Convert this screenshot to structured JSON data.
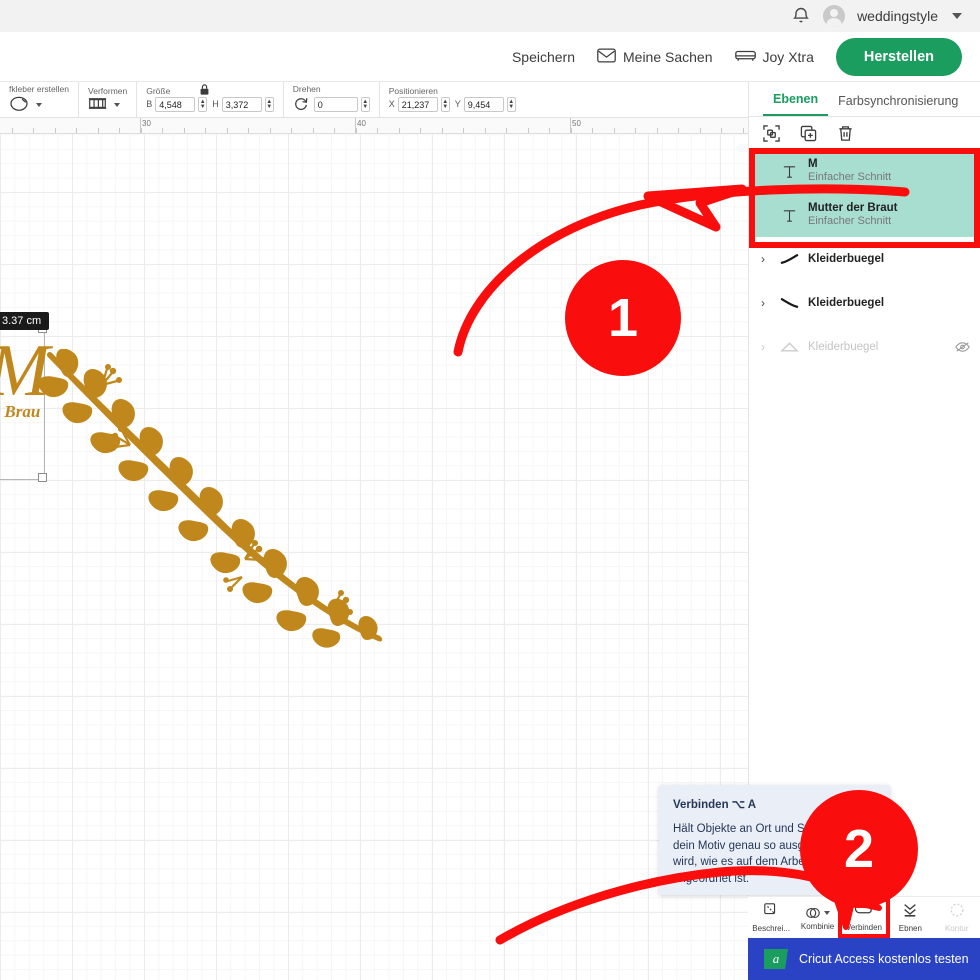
{
  "account_bar": {
    "bell_icon": "bell-icon",
    "avatar_icon": "avatar",
    "username": "weddingstyle",
    "caret_icon": "chevron-down-icon"
  },
  "header": {
    "save_label": "Speichern",
    "my_stuff_label": "Meine Sachen",
    "my_stuff_icon": "envelope-icon",
    "machine_label": "Joy Xtra",
    "machine_icon": "machine-icon",
    "make_button": "Herstellen",
    "make_button_color": "#1a9d5e"
  },
  "prop_toolbar": {
    "groups": [
      {
        "label": "fkleber erstellen",
        "icon": "sticker-icon",
        "has_dropdown": true
      },
      {
        "label": "Verformen",
        "icon": "warp-icon",
        "has_dropdown": true
      }
    ],
    "size": {
      "label": "Größe",
      "lock_icon": "lock-icon",
      "width_prefix": "B",
      "width_value": "4,548",
      "height_prefix": "H",
      "height_value": "3,372"
    },
    "rotate": {
      "label": "Drehen",
      "icon": "rotate-icon",
      "value": "0"
    },
    "position": {
      "label": "Positionieren",
      "x_prefix": "X",
      "x_value": "21,237",
      "y_prefix": "Y",
      "y_value": "9,454"
    }
  },
  "ruler": {
    "marks": [
      "30",
      "40",
      "50"
    ]
  },
  "canvas": {
    "size_tooltip": "3.37  cm",
    "text_letter": "M",
    "text_fragment": "er Brau",
    "artwork_color": "#c0881c",
    "artwork_name": "floral-branch"
  },
  "right_panel": {
    "tabs": [
      {
        "label": "Ebenen",
        "active": true
      },
      {
        "label": "Farbsynchronisierung",
        "active": false
      }
    ],
    "panel_icons": [
      {
        "name": "group-icon"
      },
      {
        "name": "duplicate-icon"
      },
      {
        "name": "delete-icon"
      }
    ],
    "layers": [
      {
        "title": "M",
        "subtitle": "Einfacher Schnitt",
        "icon": "text-icon",
        "selected": true,
        "hidden": false,
        "chevron": false
      },
      {
        "title": "Mutter der Braut",
        "subtitle": "Einfacher Schnitt",
        "icon": "text-icon",
        "selected": true,
        "hidden": false,
        "chevron": false
      },
      {
        "title": "Kleiderbuegel",
        "subtitle": "",
        "icon": "stroke-up-icon",
        "selected": false,
        "hidden": false,
        "chevron": true
      },
      {
        "title": "Kleiderbuegel",
        "subtitle": "",
        "icon": "stroke-down-icon",
        "selected": false,
        "hidden": false,
        "chevron": true
      },
      {
        "title": "Kleiderbuegel",
        "subtitle": "",
        "icon": "hanger-icon",
        "selected": false,
        "hidden": true,
        "chevron": true
      }
    ]
  },
  "tooltip": {
    "title": "Verbinden ⌥ A",
    "body": "Hält Objekte an Ort und Stelle, sodass dein Motiv genau so ausgeschnitten wird, wie es auf dem Arbeitsbereich angeordnet ist."
  },
  "bottom_toolbar": {
    "items": [
      {
        "label": "Beschrei...",
        "icon": "slice-icon",
        "disabled": false,
        "dropdown": false
      },
      {
        "label": "Kombinie",
        "icon": "weld-icon",
        "disabled": false,
        "dropdown": true
      },
      {
        "label": "Verbinden",
        "icon": "attach-icon",
        "disabled": false,
        "dropdown": false
      },
      {
        "label": "Ebnen",
        "icon": "flatten-icon",
        "disabled": false,
        "dropdown": false
      },
      {
        "label": "Kontur",
        "icon": "contour-icon",
        "disabled": true,
        "dropdown": false
      }
    ]
  },
  "access_banner": {
    "logo_letter": "a",
    "text": "Cricut Access kostenlos testen",
    "background": "#2a43c4"
  },
  "annotations": {
    "accent_color": "#f90d0d",
    "markers": [
      {
        "number": "1",
        "target": "layers-selection"
      },
      {
        "number": "2",
        "target": "verbinden-button"
      }
    ]
  }
}
